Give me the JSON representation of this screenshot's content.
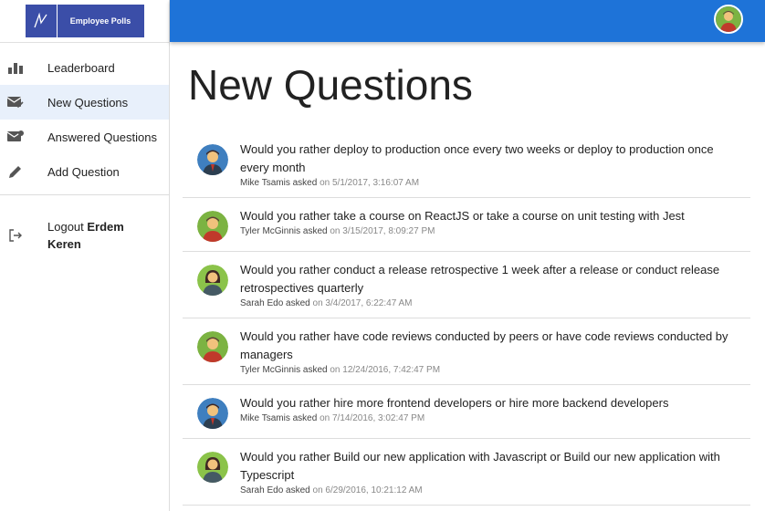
{
  "app": {
    "logo_text": "Employee Polls"
  },
  "nav": {
    "items": [
      {
        "label": "Leaderboard",
        "icon": "leaderboard-icon",
        "active": false
      },
      {
        "label": "New Questions",
        "icon": "new-questions-icon",
        "active": true
      },
      {
        "label": "Answered Questions",
        "icon": "answered-questions-icon",
        "active": false
      },
      {
        "label": "Add Question",
        "icon": "pencil-icon",
        "active": false
      }
    ],
    "logout": {
      "prefix": "Logout",
      "user": "Erdem Keren"
    }
  },
  "main": {
    "title": "New Questions",
    "asked_word": "asked",
    "questions": [
      {
        "text": "Would you rather deploy to production once every two weeks or deploy to production once every month",
        "author": "Mike Tsamis",
        "date": "on 5/1/2017, 3:16:07 AM",
        "avatar": "blue"
      },
      {
        "text": "Would you rather take a course on ReactJS or take a course on unit testing with Jest",
        "author": "Tyler McGinnis",
        "date": "on 3/15/2017, 8:09:27 PM",
        "avatar": "green"
      },
      {
        "text": "Would you rather conduct a release retrospective 1 week after a release or conduct release retrospectives quarterly",
        "author": "Sarah Edo",
        "date": "on 3/4/2017, 6:22:47 AM",
        "avatar": "green-female"
      },
      {
        "text": "Would you rather have code reviews conducted by peers or have code reviews conducted by managers",
        "author": "Tyler McGinnis",
        "date": "on 12/24/2016, 7:42:47 PM",
        "avatar": "green"
      },
      {
        "text": "Would you rather hire more frontend developers or hire more backend developers",
        "author": "Mike Tsamis",
        "date": "on 7/14/2016, 3:02:47 PM",
        "avatar": "blue"
      },
      {
        "text": "Would you rather Build our new application with Javascript or Build our new application with Typescript",
        "author": "Sarah Edo",
        "date": "on 6/29/2016, 10:21:12 AM",
        "avatar": "green-female"
      }
    ]
  },
  "colors": {
    "topbar": "#1e73d8",
    "logo_bg": "#3b4ea8",
    "active_nav": "#e8f0fb"
  }
}
